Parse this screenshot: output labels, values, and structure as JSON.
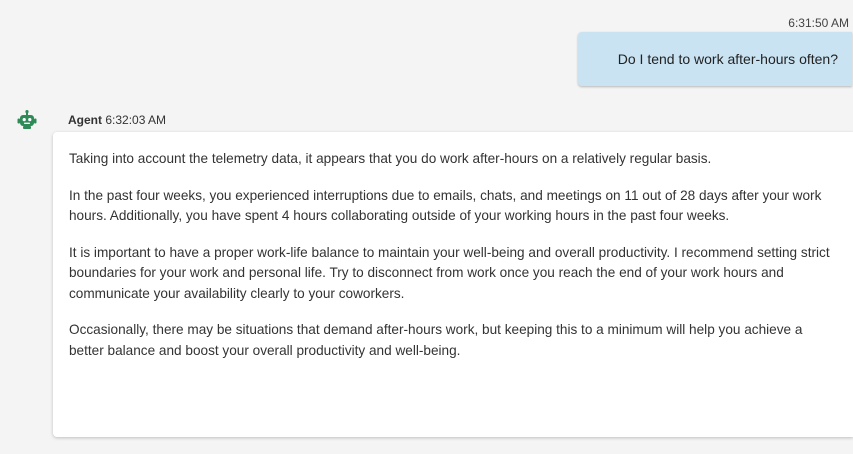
{
  "user_message": {
    "timestamp": "6:31:50 AM",
    "text": "Do I tend to work after-hours often?"
  },
  "agent_message": {
    "icon": "robot-icon",
    "name": "Agent",
    "timestamp": "6:32:03 AM",
    "paragraphs": [
      "Taking into account the telemetry data, it appears that you do work after-hours on a relatively regular basis.",
      "In the past four weeks, you experienced interruptions due to emails, chats, and meetings on 11 out of 28 days after your work hours. Additionally, you have spent 4 hours collaborating outside of your working hours in the past four weeks.",
      "It is important to have a proper work-life balance to maintain your well-being and overall productivity. I recommend setting strict boundaries for your work and personal life. Try to disconnect from work once you reach the end of your work hours and communicate your availability clearly to your coworkers.",
      "Occasionally, there may be situations that demand after-hours work, but keeping this to a minimum will help you achieve a better balance and boost your overall productivity and well-being."
    ]
  },
  "colors": {
    "user_bubble": "#c9e3f3",
    "agent_icon": "#2e8b57",
    "background": "#f4f4f4"
  }
}
